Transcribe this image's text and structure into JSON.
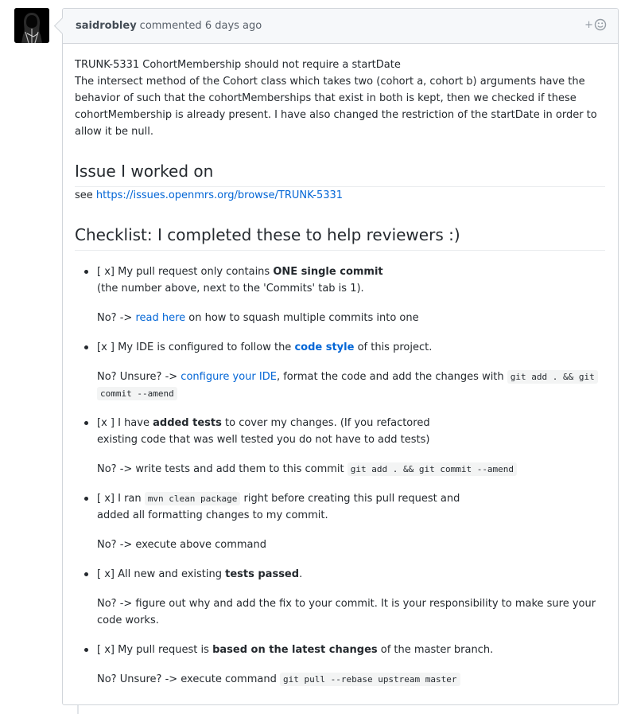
{
  "comment": {
    "author": "saidrobley",
    "action": "commented",
    "time": "6 days ago",
    "reaction_plus": "+"
  },
  "body": {
    "title_line": "TRUNK-5331 CohortMembership should not require a startDate",
    "description": "The intersect method of the Cohort class which takes two (cohort a, cohort b) arguments have the behavior of such that the cohortMemberships that exist in both is kept, then we checked if these cohortMembership is already present. I have also changed the restriction of the startDate in order to allow it be null.",
    "issue_heading": "Issue I worked on",
    "see_prefix": "see",
    "see_link": "https://issues.openmrs.org/browse/TRUNK-5331",
    "checklist_heading": "Checklist: I completed these to help reviewers :)"
  },
  "checklist": {
    "item1": {
      "prefix": "[ x] My pull request only contains ",
      "bold": "ONE single commit",
      "line2": "(the number above, next to the 'Commits' tab is 1).",
      "no_prefix": "No? -> ",
      "no_link": "read here",
      "no_suffix": " on how to squash multiple commits into one"
    },
    "item2": {
      "prefix": "[x ] My IDE is configured to follow the ",
      "link": "code style",
      "suffix": " of this project.",
      "no_prefix": "No? Unsure? -> ",
      "no_link": "configure your IDE",
      "no_mid": ", format the code and add the changes with ",
      "code_a": "git add . && git",
      "code_b": "commit --amend"
    },
    "item3": {
      "prefix": "[x ] I have ",
      "bold": "added tests",
      "suffix": " to cover my changes. (If you refactored",
      "line2": "existing code that was well tested you do not have to add tests)",
      "no_text": "No? -> write tests and add them to this commit ",
      "code": "git add . && git commit --amend"
    },
    "item4": {
      "prefix": "[ x] I ran ",
      "code": "mvn clean package",
      "suffix": " right before creating this pull request and",
      "line2": "added all formatting changes to my commit.",
      "no_text": "No? -> execute above command"
    },
    "item5": {
      "prefix": "[ x] All new and existing ",
      "bold": "tests passed",
      "suffix": ".",
      "no_text": "No? -> figure out why and add the fix to your commit. It is your responsibility to make sure your code works."
    },
    "item6": {
      "prefix": "[ x] My pull request is ",
      "bold": "based on the latest changes",
      "suffix": " of the master branch.",
      "no_text": "No? Unsure? -> execute command ",
      "code": "git pull --rebase upstream master"
    }
  }
}
